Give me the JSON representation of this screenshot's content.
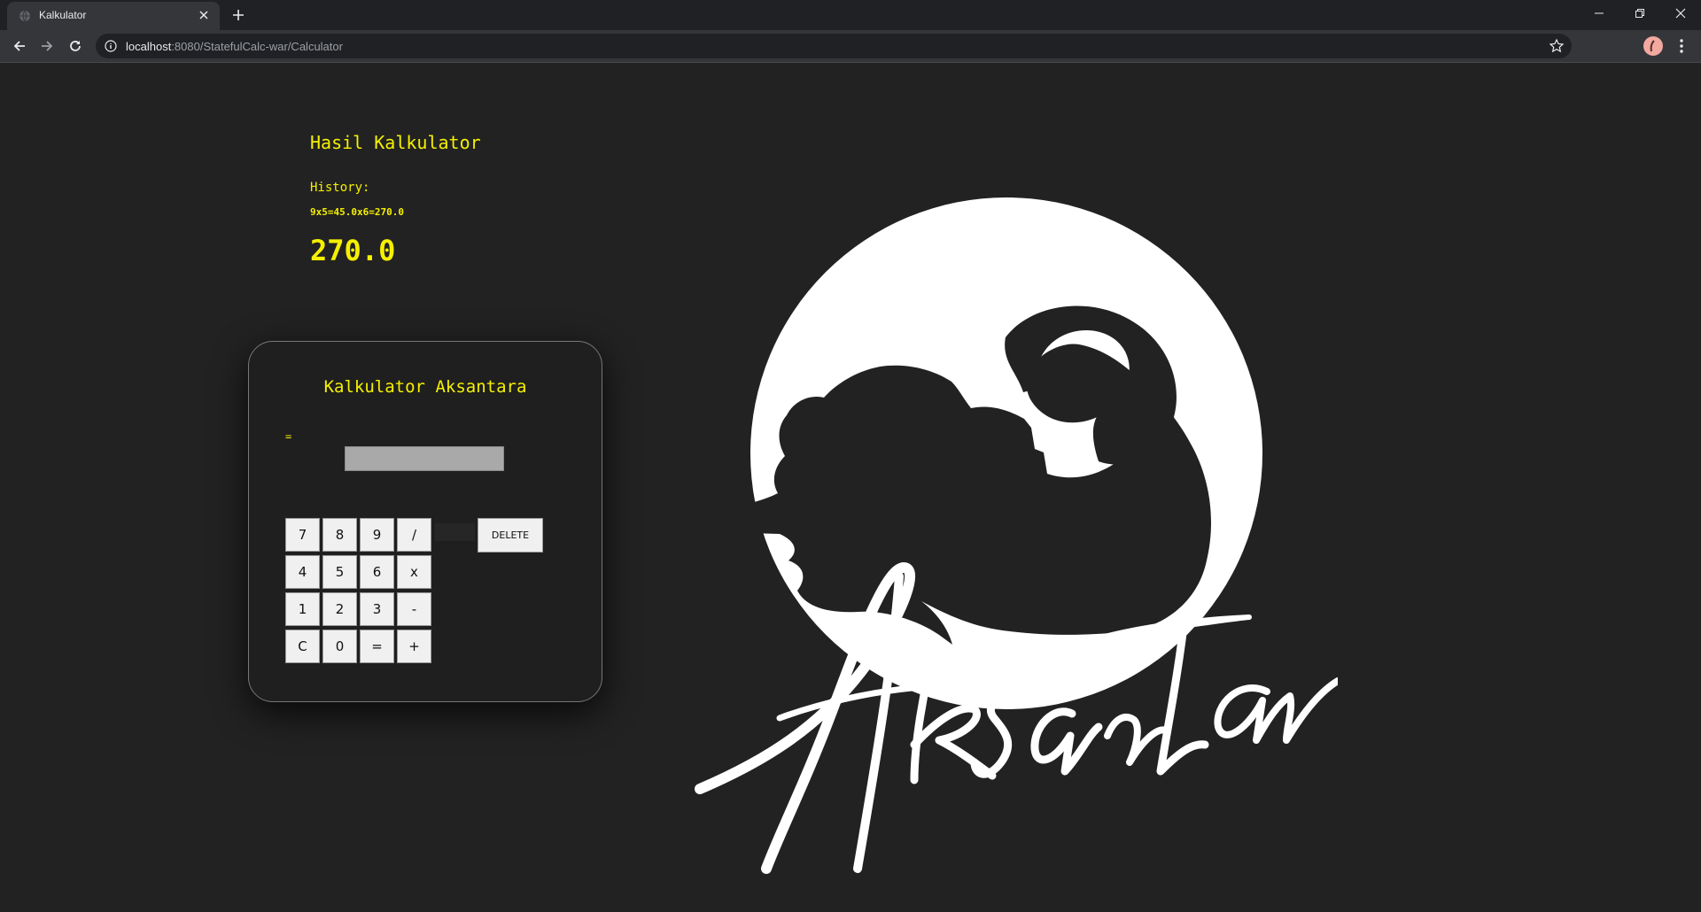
{
  "browser": {
    "tab_title": "Kalkulator",
    "url_host": "localhost",
    "url_rest": ":8080/StatefulCalc-war/Calculator"
  },
  "result": {
    "title": "Hasil Kalkulator",
    "history_label": "History:",
    "history_value": "9x5=45.0x6=270.0",
    "value": "270.0"
  },
  "calculator": {
    "title": "Kalkulator Aksantara",
    "expression": "=",
    "display_value": "",
    "keys": [
      "7",
      "8",
      "9",
      "/",
      "4",
      "5",
      "6",
      "x",
      "1",
      "2",
      "3",
      "-",
      "C",
      "0",
      "=",
      "+"
    ],
    "delete_label": "DELETE"
  },
  "logo": {
    "text": "Aksantara",
    "background_color": "#222222",
    "foreground_color": "#ffffff"
  },
  "colors": {
    "accent": "#f5f000",
    "page_background": "#222222"
  }
}
